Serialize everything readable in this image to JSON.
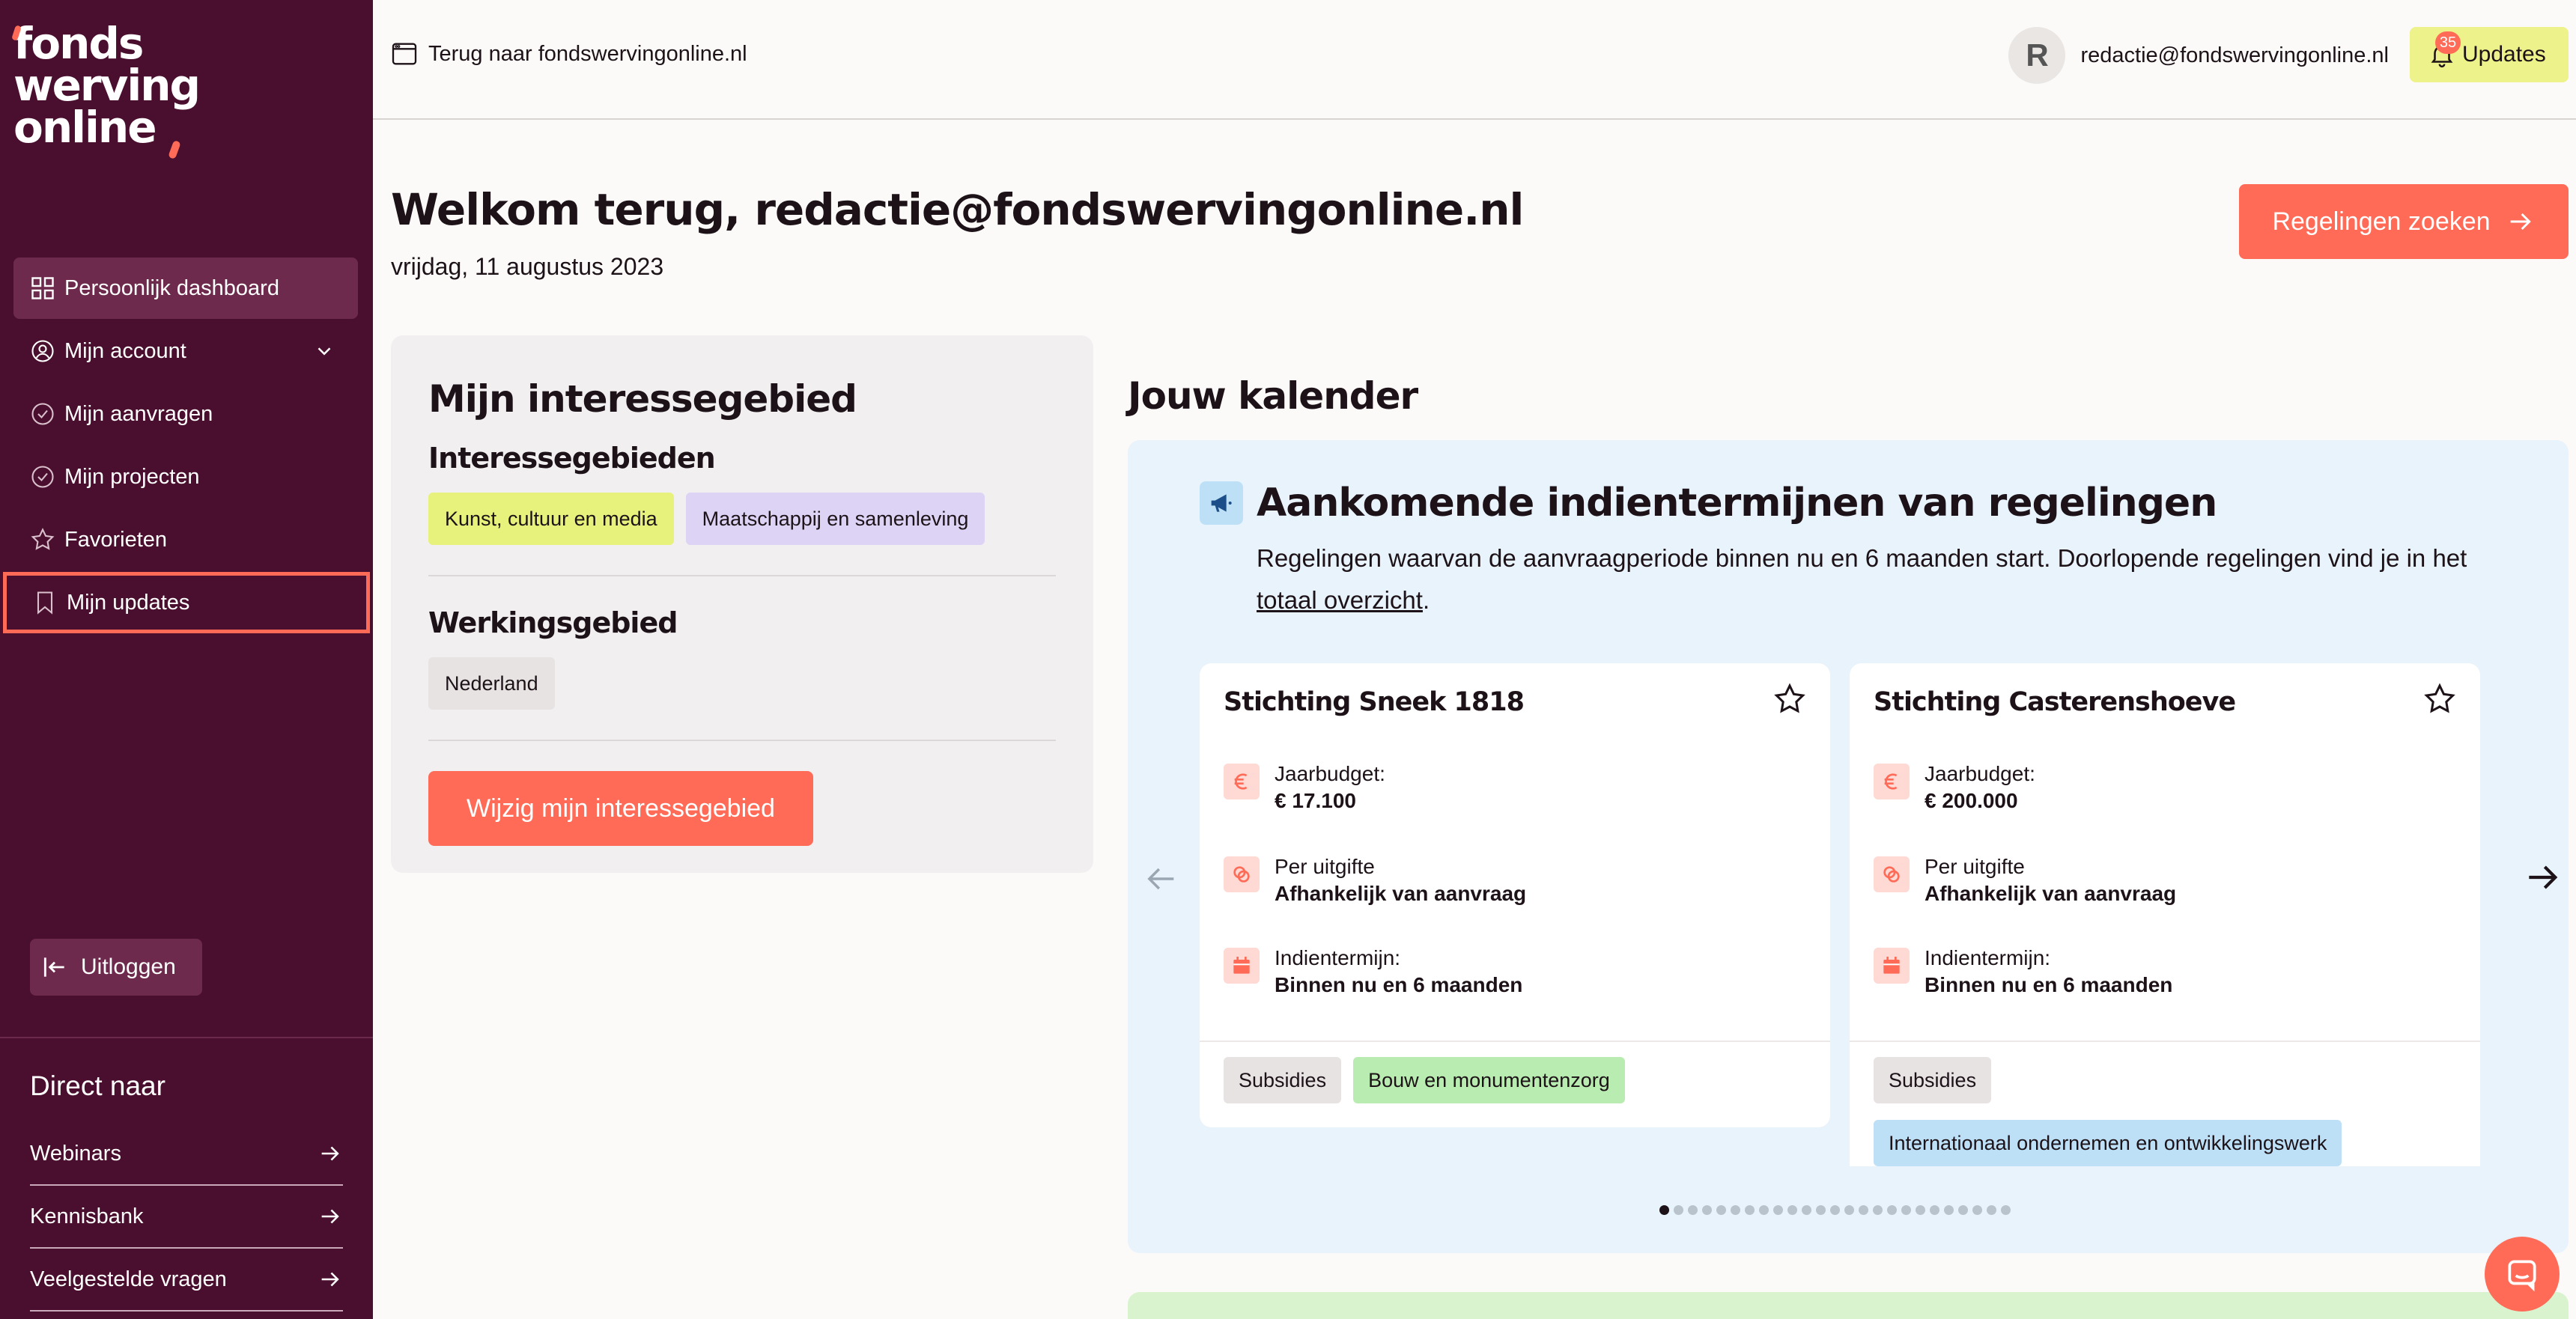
{
  "logo": {
    "line1": "fonds",
    "line2": "werving",
    "line3": "online"
  },
  "sidebar": {
    "items": [
      {
        "label": "Persoonlijk dashboard",
        "icon": "grid-icon"
      },
      {
        "label": "Mijn account",
        "icon": "user-circle-icon"
      },
      {
        "label": "Mijn aanvragen",
        "icon": "check-circle-icon"
      },
      {
        "label": "Mijn projecten",
        "icon": "check-circle-icon"
      },
      {
        "label": "Favorieten",
        "icon": "star-icon"
      },
      {
        "label": "Mijn updates",
        "icon": "bookmark-icon"
      }
    ],
    "logout_label": "Uitloggen",
    "direct_title": "Direct naar",
    "direct_links": [
      "Webinars",
      "Kennisbank",
      "Veelgestelde vragen"
    ]
  },
  "topbar": {
    "back_label": "Terug naar fondswervingonline.nl",
    "avatar_letter": "R",
    "user_email": "redactie@fondswervingonline.nl",
    "updates_label": "Updates",
    "updates_count": "35"
  },
  "main": {
    "welcome": "Welkom terug, redactie@fondswervingonline.nl",
    "date": "vrijdag, 11 augustus 2023",
    "search_button": "Regelingen zoeken"
  },
  "interest": {
    "title": "Mijn interessegebied",
    "areas_title": "Interessegebieden",
    "areas": [
      "Kunst, cultuur en media",
      "Maatschappij en samenleving"
    ],
    "region_title": "Werkingsgebied",
    "regions": [
      "Nederland"
    ],
    "edit_button": "Wijzig mijn interessegebied"
  },
  "calendar": {
    "title": "Jouw kalender",
    "panel_title": "Aankomende indientermijnen van regelingen",
    "desc_prefix": "Regelingen waarvan de aanvraagperiode binnen nu en 6 maanden start. Doorlopende regelingen vind je in het ",
    "desc_link": "totaal overzicht",
    "desc_suffix": ".",
    "cards": [
      {
        "title": "Stichting Sneek 1818",
        "budget_label": "Jaarbudget:",
        "budget_value": "€ 17.100",
        "per_label": "Per uitgifte",
        "per_value": "Afhankelijk van aanvraag",
        "term_label": "Indientermijn:",
        "term_value": "Binnen nu en 6 maanden",
        "tags": [
          "Subsidies",
          "Bouw en monumentenzorg"
        ]
      },
      {
        "title": "Stichting Casterenshoeve",
        "budget_label": "Jaarbudget:",
        "budget_value": "€ 200.000",
        "per_label": "Per uitgifte",
        "per_value": "Afhankelijk van aanvraag",
        "term_label": "Indientermijn:",
        "term_value": "Binnen nu en 6 maanden",
        "tags": [
          "Subsidies",
          "Internationaal ondernemen en ontwikkelingswerk"
        ]
      }
    ],
    "page_count": 25,
    "active_page": 1
  },
  "colors": {
    "sidebar": "#4a0f2e",
    "accent": "#ff6b57",
    "updates": "#eef28a",
    "panel": "#e9f3fb"
  }
}
